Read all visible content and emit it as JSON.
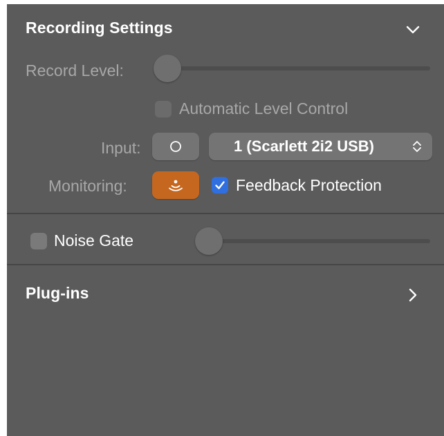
{
  "recording_settings": {
    "title": "Recording Settings",
    "collapse_icon": "chevron-down-icon",
    "record_level": {
      "label": "Record Level:",
      "value": 0
    },
    "automatic_level_control": {
      "label": "Automatic Level Control",
      "checked": false,
      "enabled": false
    },
    "input": {
      "label": "Input:",
      "mono_stereo_icon": "mono-circle-icon",
      "selected_device": "1  (Scarlett 2i2 USB)",
      "select_icon": "up-down-chevron-icon"
    },
    "monitoring": {
      "label": "Monitoring:",
      "monitor_icon": "monitoring-waves-icon",
      "active": true,
      "feedback_protection": {
        "label": "Feedback Protection",
        "checked": true
      }
    }
  },
  "noise_gate": {
    "label": "Noise Gate",
    "checked": false,
    "value": 0
  },
  "plugins": {
    "title": "Plug-ins",
    "expand_icon": "chevron-right-icon"
  },
  "colors": {
    "panel_bg": "#5b5b5b",
    "accent_blue": "#2f6fdf",
    "monitor_orange": "#c6671f"
  }
}
